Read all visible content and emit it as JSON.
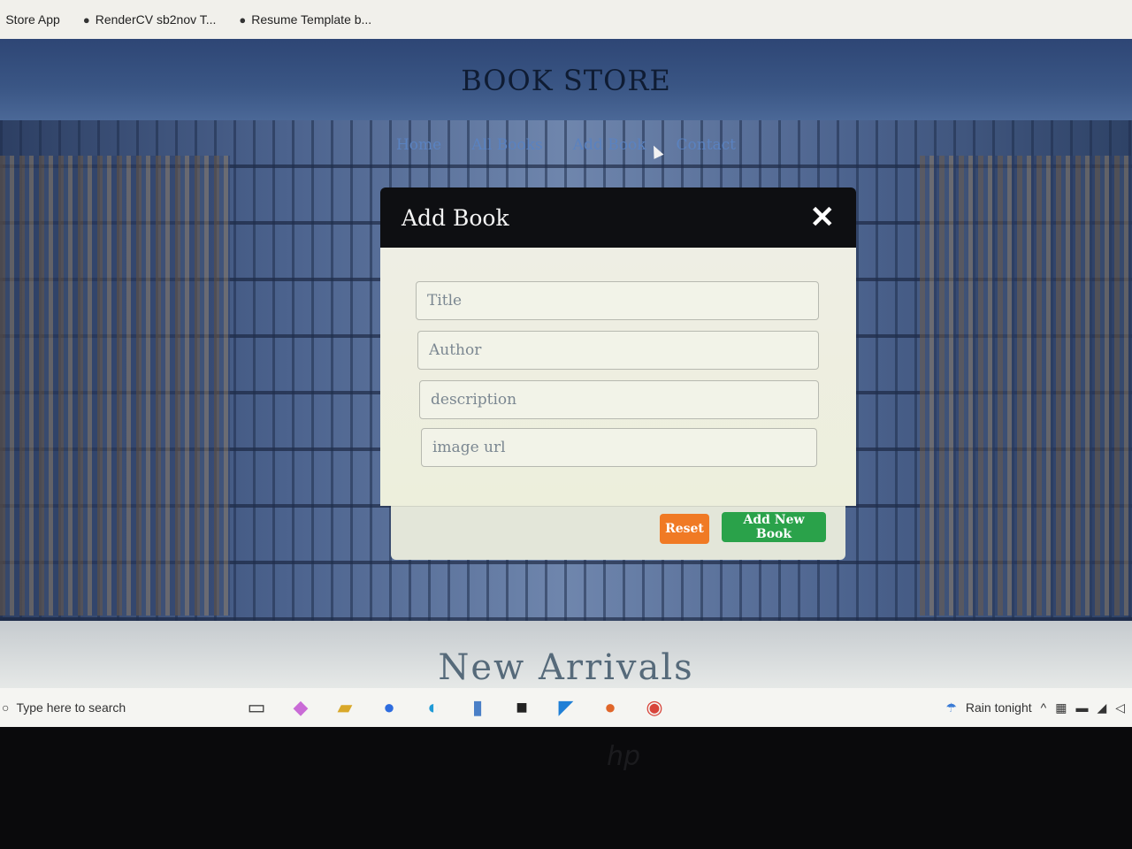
{
  "bookmarks": [
    {
      "label": "Store App"
    },
    {
      "label": "RenderCV sb2nov T..."
    },
    {
      "label": "Resume Template b..."
    }
  ],
  "site": {
    "title": "BOOK STORE",
    "nav": [
      "Home",
      "All Books",
      "Add Book",
      "Contact"
    ],
    "section_heading": "New Arrivals"
  },
  "modal": {
    "title": "Add Book",
    "close_symbol": "✕",
    "fields": {
      "title_placeholder": "Title",
      "author_placeholder": "Author",
      "description_placeholder": "description",
      "image_placeholder": "image url"
    },
    "buttons": {
      "reset": "Reset",
      "add": "Add New Book"
    }
  },
  "taskbar": {
    "search_placeholder": "Type here to search",
    "weather": "Rain tonight"
  },
  "colors": {
    "reset_button": "#f07a24",
    "add_button": "#2aa24a",
    "modal_header": "#0e0f12",
    "nav_link": "#5a82c0"
  }
}
